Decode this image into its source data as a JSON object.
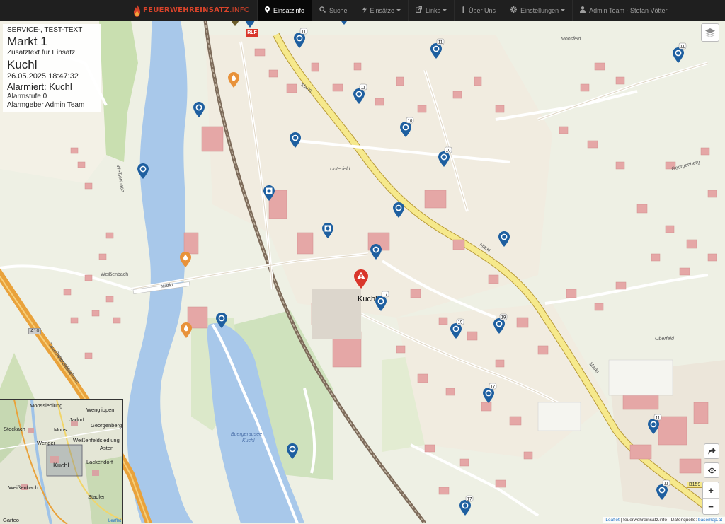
{
  "navbar": {
    "brand": "FEUERWEHREINSATZ",
    "brand_suffix": ".INFO",
    "items": [
      {
        "label": "Einsatzinfo",
        "icon": "map-pin-icon",
        "active": true,
        "dropdown": false
      },
      {
        "label": "Suche",
        "icon": "search-icon",
        "active": false,
        "dropdown": false
      },
      {
        "label": "Einsätze",
        "icon": "bolt-icon",
        "active": false,
        "dropdown": true
      },
      {
        "label": "Links",
        "icon": "external-link-icon",
        "active": false,
        "dropdown": true
      },
      {
        "label": "Über Uns",
        "icon": "info-icon",
        "active": false,
        "dropdown": false
      },
      {
        "label": "Einstellungen",
        "icon": "gear-icon",
        "active": false,
        "dropdown": true
      },
      {
        "label": "Admin Team - Stefan Vötter",
        "icon": "user-icon",
        "active": false,
        "dropdown": false
      }
    ]
  },
  "incident": {
    "category": "SERVICE-, TEST-TEXT",
    "location": "Markt 1",
    "extra_text": "Zusatztext für Einsatz",
    "municipality": "Kuchl",
    "datetime": "26.05.2025 18:47:32",
    "alerted": "Alarmiert: Kuchl",
    "alarm_level": "Alarmstufe 0",
    "alarm_source": "Alarmgeber Admin Team"
  },
  "map": {
    "labels": {
      "town": "Kuchl",
      "lake": "Buergerausee Kuchl",
      "lake_line1": "Buergerausee",
      "lake_line2": "Kuchl",
      "road_markt": "Markt",
      "road_weissenbach": "Weißenbach",
      "autobahn": "Tauern Autobahn",
      "a10": "A10",
      "b159": "B159",
      "oberfeld": "Oberfeld",
      "mooshield": "Moosfeld",
      "unterfeld": "Unterfeld",
      "georgenberg": "Georgenberg",
      "vehicle": "RLF"
    },
    "marker_counts": [
      "11",
      "11",
      "11",
      "11",
      "10",
      "10",
      "17",
      "19",
      "19",
      "17",
      "11",
      "11",
      "10",
      "17",
      "9"
    ],
    "colors": {
      "hydrant_orange": "#e8923a",
      "marker_blue": "#1e5fa0",
      "incident_red": "#d9362b",
      "river": "#a8c8ea",
      "road_major": "#f4e68a"
    }
  },
  "minimap": {
    "labels": [
      "Moossiedlung",
      "Wenglippen",
      "Stockach",
      "Jadorf",
      "Georgenberg",
      "Moos",
      "Weißenfeldsiedlung",
      "Wenger",
      "Asten",
      "Kuchl",
      "Lackendorf",
      "Weißenbach",
      "Stadler",
      "Garteo"
    ],
    "attribution": "Leaflet"
  },
  "attribution": {
    "leaflet": "Leaflet",
    "text": " | feuerwehreinsatz.info - Datenquelle: ",
    "source": "basemap.at"
  }
}
